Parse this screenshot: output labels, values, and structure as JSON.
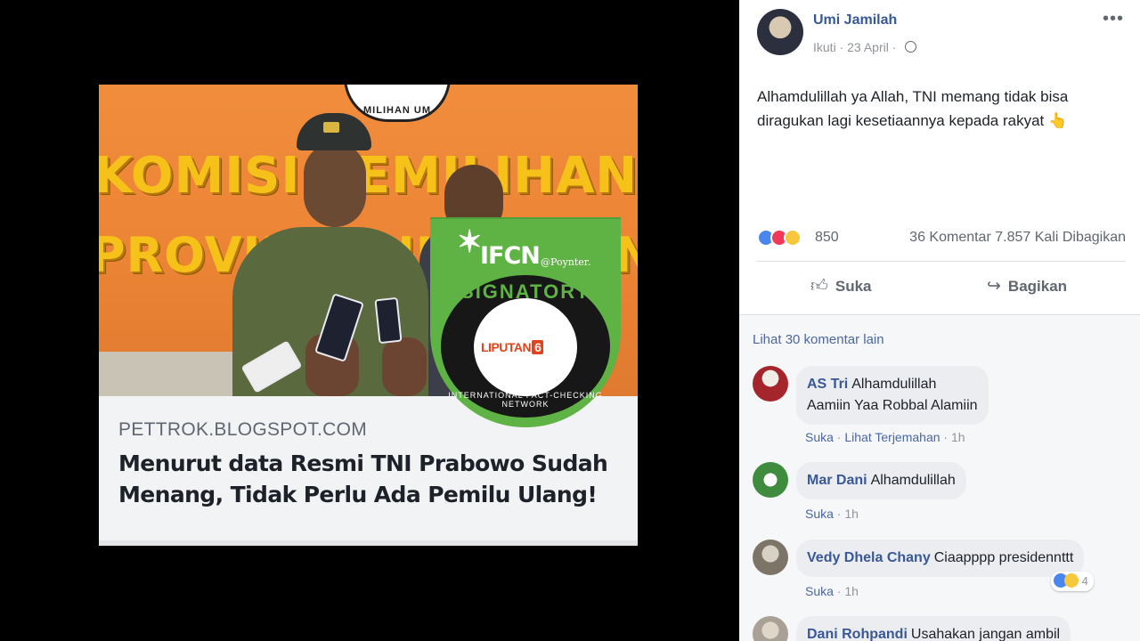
{
  "article": {
    "domain": "PETTROK.BLOGSPOT.COM",
    "title": "Menurut data Resmi TNI Prabowo Sudah Menang, Tidak Perlu Ada Pemilu Ulang!",
    "wall_sign_line1": "KOMISI PEMILIHAN UMUM",
    "wall_sign_line2": "PROVINSI NUSA TENGGARA BARAT",
    "kpu_logo_text": "MILIHAN UM"
  },
  "badge": {
    "org": "IFCN",
    "poynter": "@Poynter.",
    "signatory": "SIGNATORY",
    "network": "INTERNATIONAL FACT-CHECKING NETWORK",
    "member": "LIPUTAN",
    "member_suffix": "6"
  },
  "post": {
    "author": "Umi Jamilah",
    "follow": "Ikuti",
    "date": "23 April",
    "text": "Alhamdulillah ya Allah, TNI memang tidak bisa diragukan lagi kesetiaannya kepada rakyat 👆",
    "more": "•••",
    "reaction_count": "850",
    "stats": "36 Komentar  7.857 Kali Dibagikan",
    "like_label": "Suka",
    "share_label": "Bagikan"
  },
  "comments": {
    "more_label": "Lihat 30 komentar lain",
    "items": [
      {
        "author": "AS Tri",
        "text1": "Alhamdulillah",
        "text2": "Aamiin Yaa Robbal Alamiin",
        "like": "Suka",
        "translate": "Lihat Terjemahan",
        "time": "1h"
      },
      {
        "author": "Mar Dani",
        "text1": "Alhamdulillah",
        "like": "Suka",
        "time": "1h"
      },
      {
        "author": "Vedy Dhela Chany",
        "text1": "Ciaapppp presidennttt",
        "like": "Suka",
        "time": "1h",
        "reactions": "4"
      },
      {
        "author": "Dani Rohpandi",
        "text1": "Usahakan jangan ambil"
      }
    ]
  },
  "colors": {
    "link": "#365899",
    "ifcn_green": "#5fb344",
    "wall_orange": "#ec8435",
    "sign_yellow": "#f6c21a"
  },
  "icons": {
    "globe": "globe-icon",
    "more": "more-icon",
    "like": "thumbs-up-icon",
    "share": "share-arrow-icon"
  }
}
